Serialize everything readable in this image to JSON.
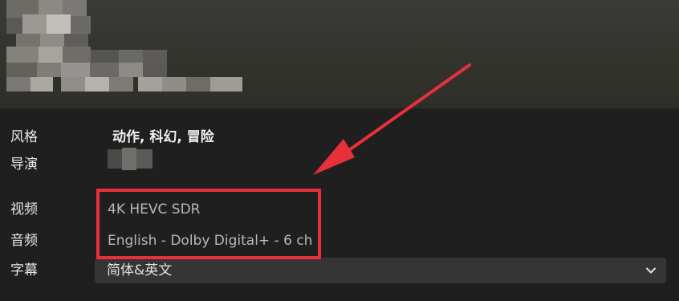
{
  "details": {
    "genre_label": "风格",
    "genre_value": "动作, 科幻, 冒险",
    "director_label": "导演",
    "video_label": "视频",
    "video_value": "4K HEVC SDR",
    "audio_label": "音频",
    "audio_value": "English - Dolby Digital+ - 6 ch",
    "subtitle_label": "字幕",
    "subtitle_value": "简体&英文"
  },
  "icons": {
    "dropdown": "chevron-down-icon"
  },
  "colors": {
    "background": "#1f1f1f",
    "annotation": "#e8303a",
    "select_background": "#353535"
  }
}
